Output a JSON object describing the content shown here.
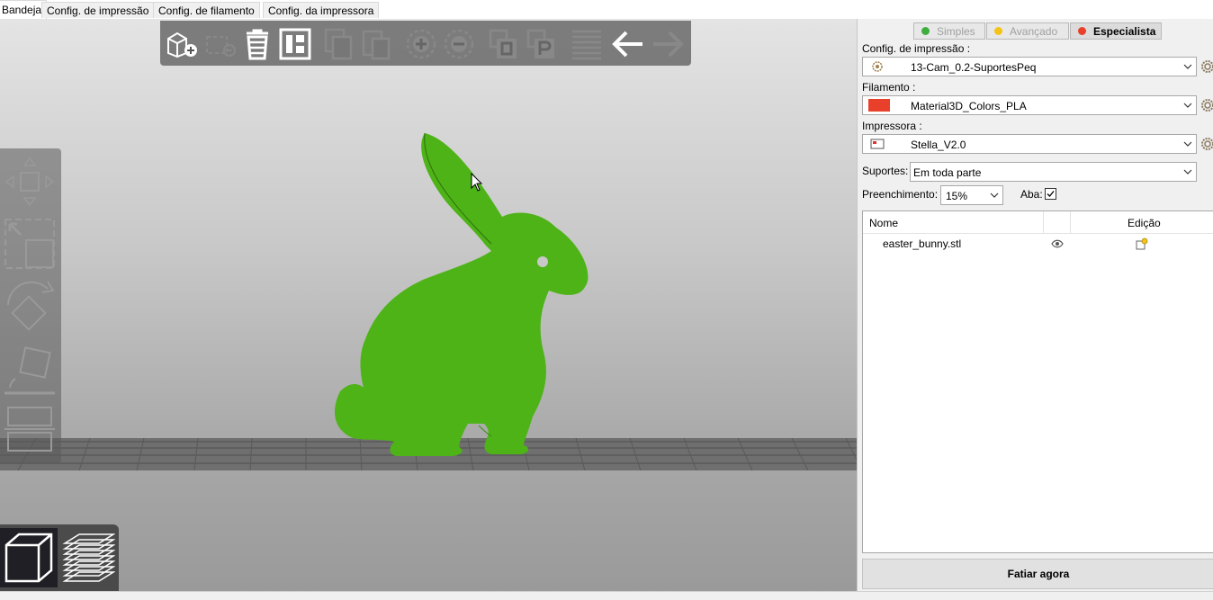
{
  "tabs": [
    {
      "label": "Bandeja"
    },
    {
      "label": "Config. de impressão"
    },
    {
      "label": "Config. de filamento"
    },
    {
      "label": "Config. da impressora"
    }
  ],
  "modes": {
    "simple": "Simples",
    "advanced": "Avançado",
    "expert": "Especialista"
  },
  "print_settings": {
    "label": "Config. de impressão :",
    "value": "13-Cam_0.2-SuportesPeq"
  },
  "filament": {
    "label": "Filamento :",
    "value": "Material3D_Colors_PLA",
    "color": "#e8402a"
  },
  "printer": {
    "label": "Impressora :",
    "value": "Stella_V2.0"
  },
  "supports": {
    "label": "Suportes:",
    "value": "Em toda parte"
  },
  "infill": {
    "label": "Preenchimento:",
    "value": "15%"
  },
  "brim": {
    "label": "Aba:",
    "checked": true
  },
  "object_list": {
    "col_name": "Nome",
    "col_edit": "Edição",
    "items": [
      {
        "name": "easter_bunny.stl"
      }
    ]
  },
  "slice_button": "Fatiar agora",
  "colors": {
    "model": "#4db317",
    "simple_dot": "#3fae3f",
    "advanced_dot": "#f3c318",
    "expert_dot": "#e8402a"
  }
}
